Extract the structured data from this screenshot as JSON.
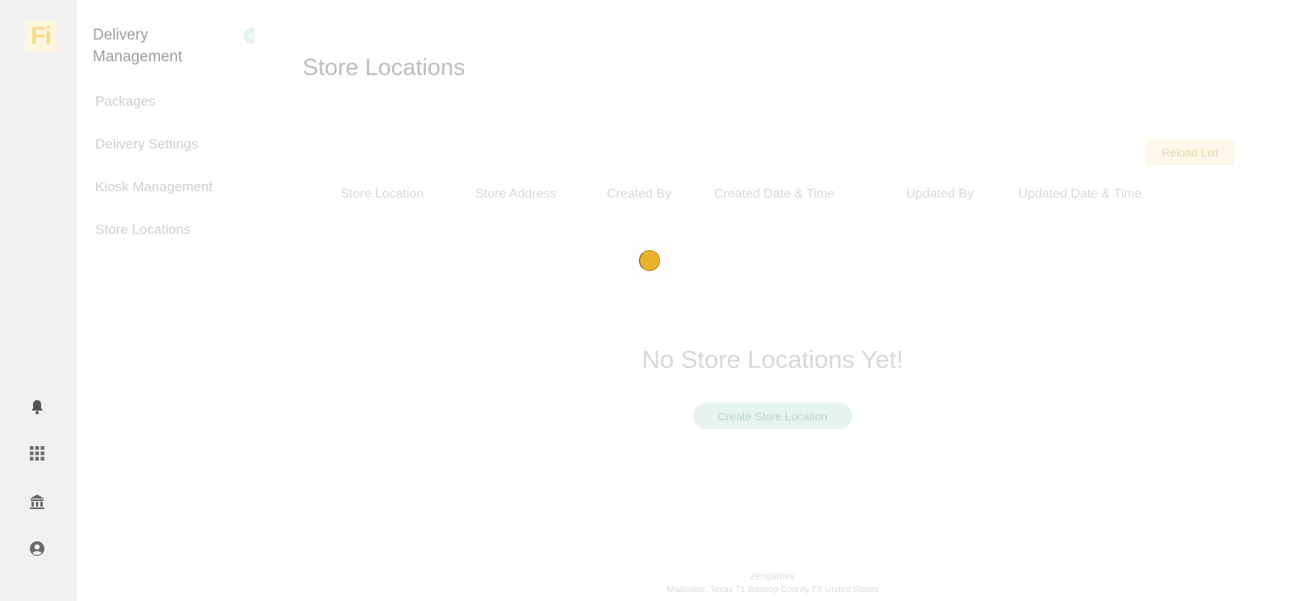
{
  "brand": {
    "logo_text": "Fi"
  },
  "rail": {
    "items": [
      {
        "icon": "bell-icon",
        "label": "Notifications"
      },
      {
        "icon": "apps-grid-icon",
        "label": "Apps"
      },
      {
        "icon": "bank-icon",
        "label": "Organization"
      },
      {
        "icon": "user-circle-icon",
        "label": "Account"
      }
    ]
  },
  "subnav": {
    "title": "Delivery Management",
    "items": [
      {
        "label": "Packages"
      },
      {
        "label": "Delivery Settings"
      },
      {
        "label": "Kiosk Management"
      },
      {
        "label": "Store Locations"
      }
    ]
  },
  "main": {
    "title": "Store Locations",
    "reload_label": "Reload List",
    "columns": [
      "Store Location",
      "Store Address",
      "Created By",
      "Created Date & Time",
      "Updated By",
      "Updated Date & Time"
    ],
    "empty_text": "No Store Locations Yet!",
    "create_label": "Create Store Location",
    "loading": true
  },
  "footer": {
    "name": "zengames",
    "address": "Malibaker, Texas 71 Bastrop County TX United States"
  },
  "colors": {
    "accent_gold": "#e9b22d",
    "accent_green": "#2e9a7b",
    "rail_bg": "#f1f1f1"
  }
}
